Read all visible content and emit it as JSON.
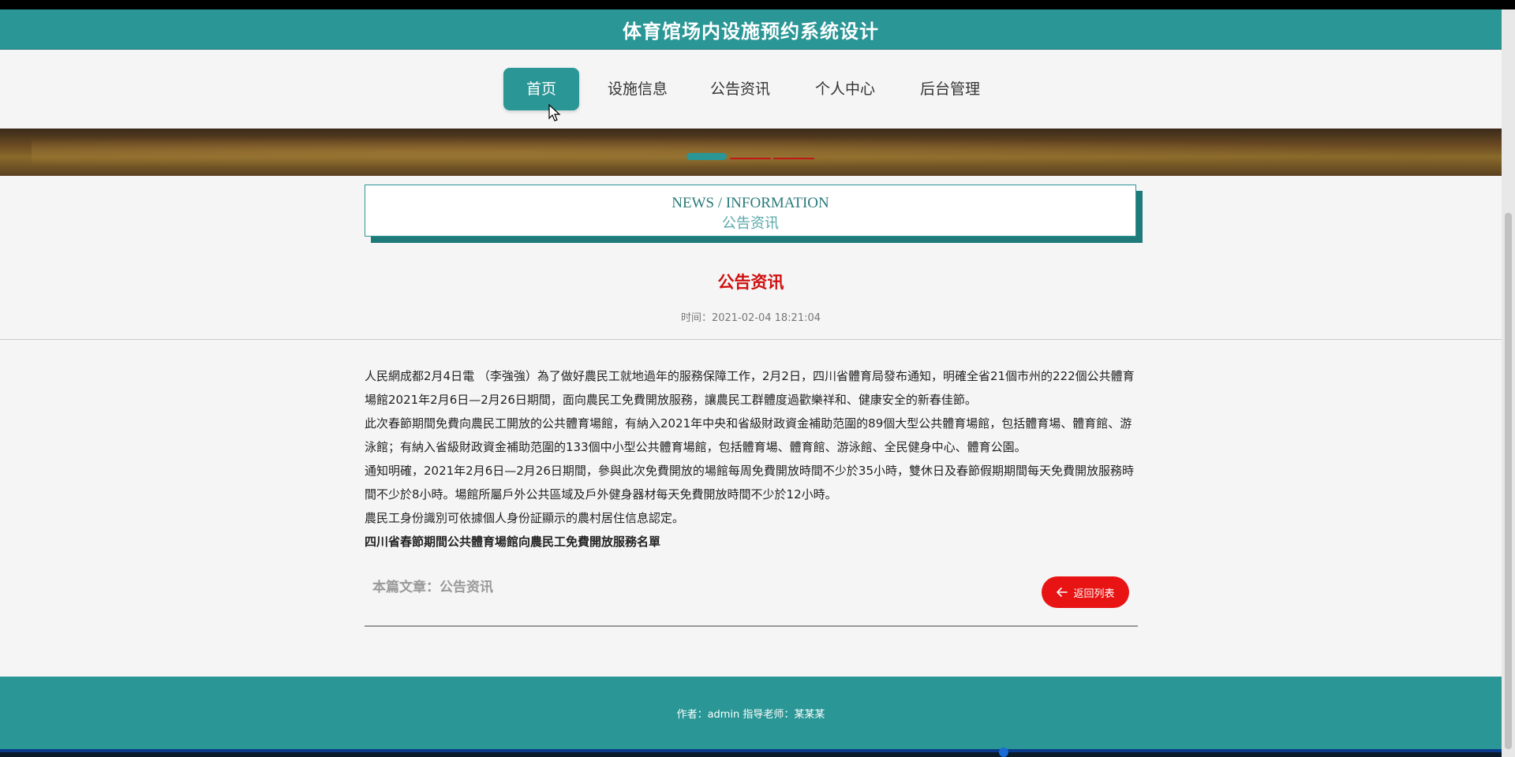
{
  "header": {
    "title": "体育馆场内设施预约系统设计"
  },
  "nav": {
    "items": [
      {
        "label": "首页",
        "active": true
      },
      {
        "label": "设施信息",
        "active": false
      },
      {
        "label": "公告资讯",
        "active": false
      },
      {
        "label": "个人中心",
        "active": false
      },
      {
        "label": "后台管理",
        "active": false
      }
    ]
  },
  "section": {
    "en_title": "NEWS / INFORMATION",
    "cn_title": "公告资讯"
  },
  "article": {
    "title": "公告资讯",
    "time": "时间：2021-02-04 18:21:04",
    "paragraphs": [
      "人民網成都2月4日電 （李強強）為了做好農民工就地過年的服務保障工作，2月2日，四川省體育局發布通知，明確全省21個市州的222個公共體育場館2021年2月6日—2月26日期間，面向農民工免費開放服務，讓農民工群體度過歡樂祥和、健康安全的新春佳節。",
      "此次春節期間免費向農民工開放的公共體育場館，有納入2021年中央和省級財政資金補助范圍的89個大型公共體育場館，包括體育場、體育館、游泳館；有納入省級財政資金補助范圍的133個中小型公共體育場館，包括體育場、體育館、游泳館、全民健身中心、體育公園。",
      "通知明確，2021年2月6日—2月26日期間，參與此次免費開放的場館每周免費開放時間不少於35小時，雙休日及春節假期期間每天免費開放服務時間不少於8小時。場館所屬戶外公共區域及戶外健身器材每天免費開放時間不少於12小時。",
      "農民工身份識別可依據個人身份証顯示的農村居住信息認定。"
    ],
    "bold_line": "四川省春節期間公共體育場館向農民工免費開放服務名單",
    "footer_label": "本篇文章：公告资讯",
    "back_label": "返回列表"
  },
  "footer": {
    "text": "作者：admin 指导老师：某某某"
  },
  "colors": {
    "primary": "#2a9696",
    "title_red": "#d01010",
    "button_red": "#e81414"
  }
}
